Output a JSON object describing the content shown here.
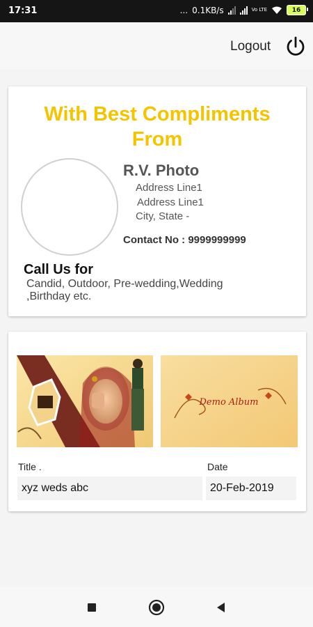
{
  "status": {
    "time": "17:31",
    "dots": "...",
    "speed": "0.1KB/s",
    "lte": "Vo LTE",
    "battery": "16"
  },
  "app_bar": {
    "logout_label": "Logout",
    "power_icon": "power-icon"
  },
  "profile_card": {
    "headline_line1": "With Best Compliments",
    "headline_line2": "From",
    "studio_name": "R.V. Photo",
    "address_line1": "Address Line1",
    "address_line2": "Address Line1",
    "address_line3": "City, State -",
    "contact": "Contact No : 9999999999",
    "call_title": "Call Us for",
    "services_line1": "Candid, Outdoor, Pre-wedding,Wedding",
    "services_line2": ",Birthday etc.",
    "accent_color": "#f4c400"
  },
  "album_card": {
    "cover_text": "Demo Album",
    "title_label": "Title .",
    "title_value": "xyz weds abc",
    "date_label": "Date",
    "date_value": "20-Feb-2019"
  },
  "nav": {
    "recents_icon": "square-icon",
    "home_icon": "circle-icon",
    "back_icon": "triangle-back-icon"
  }
}
